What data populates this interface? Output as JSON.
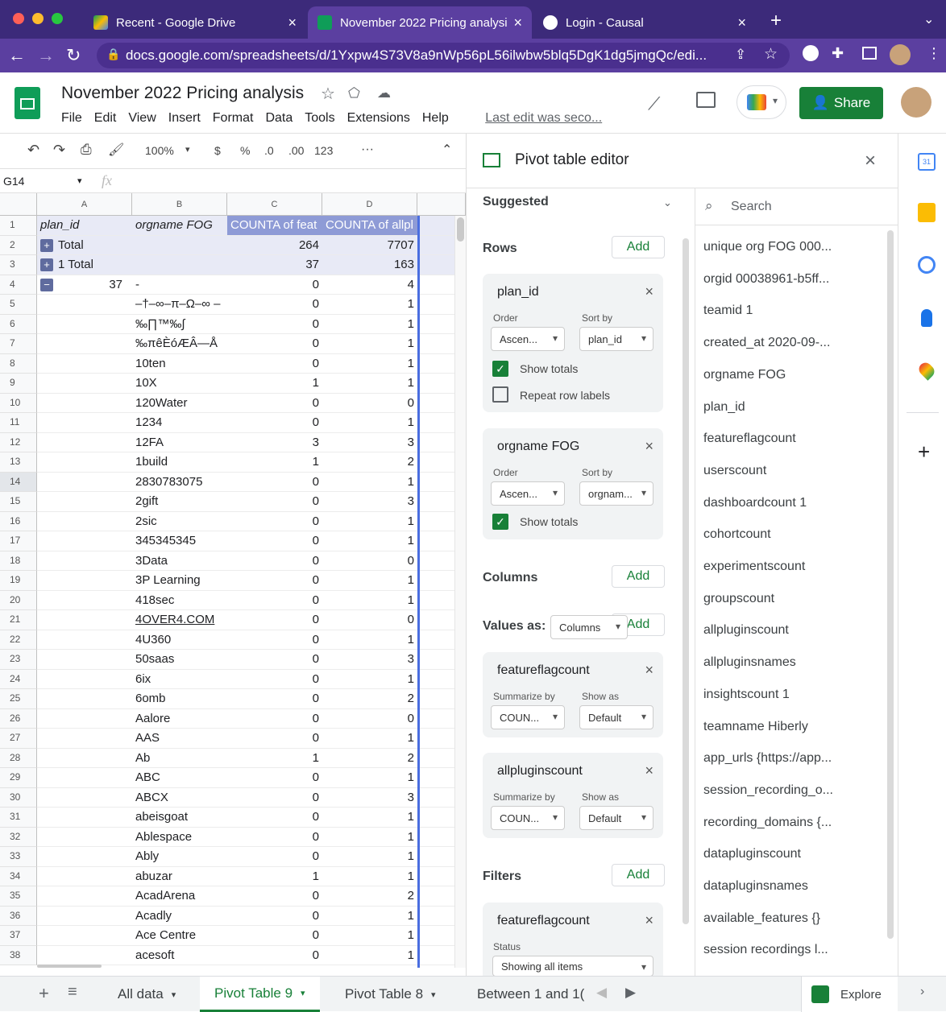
{
  "browser": {
    "tabs": [
      {
        "label": "Recent - Google Drive",
        "icon": "drive-icon"
      },
      {
        "label": "November 2022 Pricing analysis",
        "icon": "sheets-icon"
      },
      {
        "label": "Login - Causal",
        "icon": "causal-icon"
      }
    ],
    "new_tab": "+",
    "url": "docs.google.com/spreadsheets/d/1Yxpw4S73V8a9nWp56pL56ilwbw5blq5DgK1dg5jmgQc/edi..."
  },
  "doc": {
    "title": "November 2022 Pricing analysis",
    "menu": [
      "File",
      "Edit",
      "View",
      "Insert",
      "Format",
      "Data",
      "Tools",
      "Extensions",
      "Help"
    ],
    "last_edit": "Last edit was seco...",
    "share": "Share"
  },
  "toolbar": {
    "zoom": "100%",
    "currency": "$",
    "percent": "%",
    "dec_minus": ".0",
    "dec_plus": ".00",
    "format": "123",
    "more": "···"
  },
  "formula": {
    "cell_ref": "G14",
    "fx": "fx"
  },
  "grid": {
    "columns": [
      "A",
      "B",
      "C",
      "D"
    ],
    "rows": [
      [
        "1",
        "plan_id",
        "orgname FOG",
        "COUNTA of feat",
        "COUNTA of allpl"
      ],
      [
        "2",
        "Total",
        "",
        "264",
        "7707"
      ],
      [
        "3",
        "1 Total",
        "",
        "37",
        "163"
      ],
      [
        "4",
        "37",
        "-",
        "0",
        "4"
      ],
      [
        "5",
        "",
        "–†–∞–π–Ω–∞ –",
        "0",
        "1"
      ],
      [
        "6",
        "",
        "‰∏™‰∫",
        "0",
        "1"
      ],
      [
        "7",
        "",
        "‰πêÈóÆÂ—Å",
        "0",
        "1"
      ],
      [
        "8",
        "",
        "10ten",
        "0",
        "1"
      ],
      [
        "9",
        "",
        "10X",
        "1",
        "1"
      ],
      [
        "10",
        "",
        "120Water",
        "0",
        "0"
      ],
      [
        "11",
        "",
        "1234",
        "0",
        "1"
      ],
      [
        "12",
        "",
        "12FA",
        "3",
        "3"
      ],
      [
        "13",
        "",
        "1build",
        "1",
        "2"
      ],
      [
        "14",
        "",
        "2830783075",
        "0",
        "1"
      ],
      [
        "15",
        "",
        "2gift",
        "0",
        "3"
      ],
      [
        "16",
        "",
        "2sic",
        "0",
        "1"
      ],
      [
        "17",
        "",
        "345345345",
        "0",
        "1"
      ],
      [
        "18",
        "",
        "3Data",
        "0",
        "0"
      ],
      [
        "19",
        "",
        "3P Learning",
        "0",
        "1"
      ],
      [
        "20",
        "",
        "418sec",
        "0",
        "1"
      ],
      [
        "21",
        "",
        "4OVER4.COM",
        "0",
        "0"
      ],
      [
        "22",
        "",
        "4U360",
        "0",
        "1"
      ],
      [
        "23",
        "",
        "50saas",
        "0",
        "3"
      ],
      [
        "24",
        "",
        "6ix",
        "0",
        "1"
      ],
      [
        "25",
        "",
        "6omb",
        "0",
        "2"
      ],
      [
        "26",
        "",
        "Aalore",
        "0",
        "0"
      ],
      [
        "27",
        "",
        "AAS",
        "0",
        "1"
      ],
      [
        "28",
        "",
        "Ab",
        "1",
        "2"
      ],
      [
        "29",
        "",
        "ABC",
        "0",
        "1"
      ],
      [
        "30",
        "",
        "ABCX",
        "0",
        "3"
      ],
      [
        "31",
        "",
        "abeisgoat",
        "0",
        "1"
      ],
      [
        "32",
        "",
        "Ablespace",
        "0",
        "1"
      ],
      [
        "33",
        "",
        "Ably",
        "0",
        "1"
      ],
      [
        "34",
        "",
        "abuzar",
        "1",
        "1"
      ],
      [
        "35",
        "",
        "AcadArena",
        "0",
        "2"
      ],
      [
        "36",
        "",
        "Acadly",
        "0",
        "1"
      ],
      [
        "37",
        "",
        "Ace Centre",
        "0",
        "1"
      ],
      [
        "38",
        "",
        "acesoft",
        "0",
        "1"
      ]
    ]
  },
  "pivot": {
    "title": "Pivot table editor",
    "suggested": "Suggested",
    "rows_label": "Rows",
    "add": "Add",
    "columns_label": "Columns",
    "values_label": "Values as:",
    "values_mode": "Columns",
    "filters_label": "Filters",
    "order": "Order",
    "sort_by": "Sort by",
    "show_totals": "Show totals",
    "repeat_labels": "Repeat row labels",
    "summarize_by": "Summarize by",
    "show_as": "Show as",
    "status": "Status",
    "row_cards": [
      {
        "name": "plan_id",
        "order": "Ascen...",
        "sort": "plan_id"
      },
      {
        "name": "orgname FOG",
        "order": "Ascen...",
        "sort": "orgnam..."
      }
    ],
    "value_cards": [
      {
        "name": "featureflagcount",
        "summ": "COUN...",
        "show": "Default"
      },
      {
        "name": "allpluginscount",
        "summ": "COUN...",
        "show": "Default"
      }
    ],
    "filter_card": {
      "name": "featureflagcount",
      "status": "Showing all items"
    },
    "search_placeholder": "Search",
    "fields": [
      "unique org FOG 000...",
      "orgid 00038961-b5ff...",
      "teamid 1",
      "created_at 2020-09-...",
      "orgname FOG",
      "plan_id",
      "featureflagcount",
      "userscount",
      "dashboardcount 1",
      "cohortcount",
      "experimentscount",
      "groupscount",
      "allpluginscount",
      "allpluginsnames",
      "insightscount 1",
      "teamname Hiberly",
      "app_urls {https://app...",
      "session_recording_o...",
      "recording_domains {...",
      "datapluginscount",
      "datapluginsnames",
      "available_features {}",
      "session recordings l..."
    ]
  },
  "sheets": {
    "tabs": [
      "All data",
      "Pivot Table 9",
      "Pivot Table 8",
      "Between 1 and 1("
    ],
    "explore": "Explore"
  },
  "colors": {
    "accent": "#188038",
    "browser": "#3c2a7a",
    "pivot_header": "#8e9bd6"
  }
}
